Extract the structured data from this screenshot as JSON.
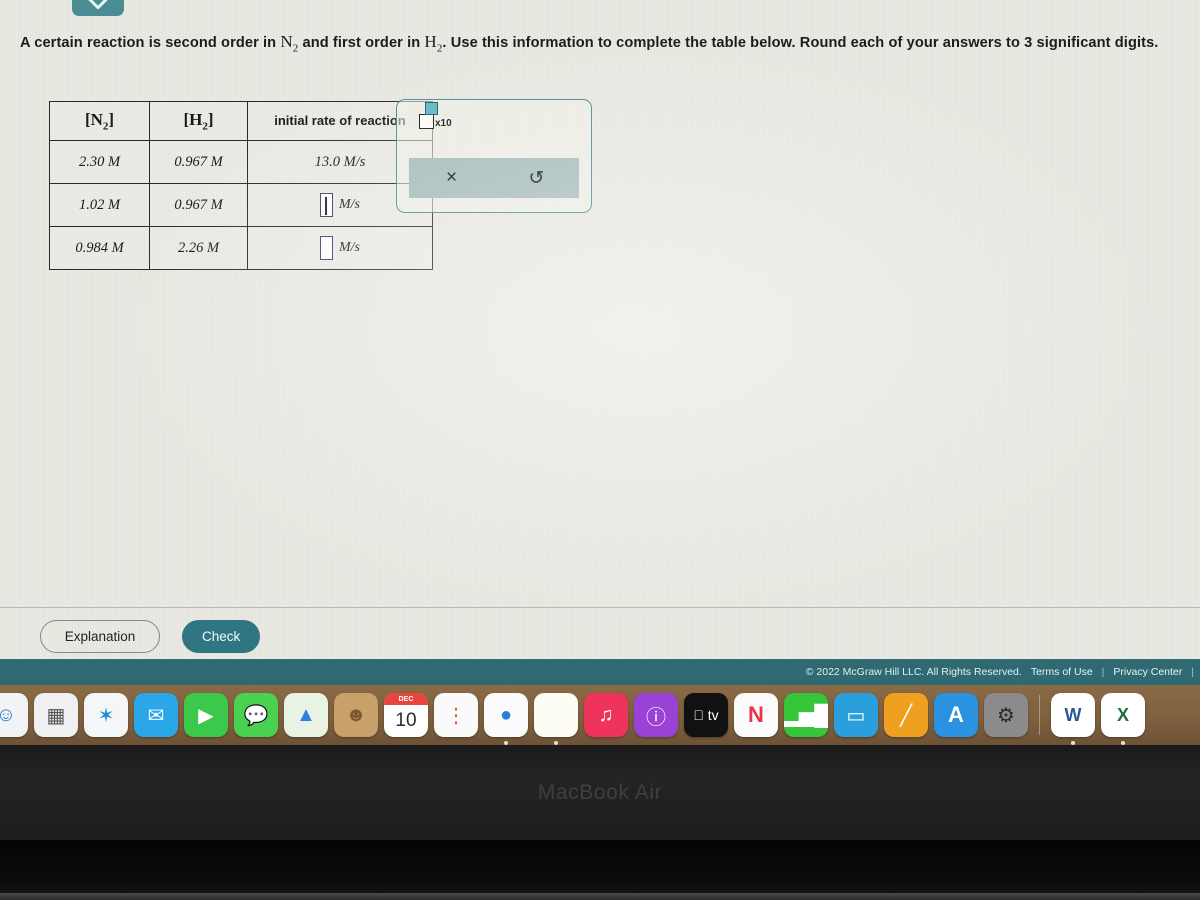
{
  "problem": {
    "text_part1": "A certain reaction is second order in ",
    "species1": "N",
    "species1_sub": "2",
    "text_part2": " and first order in ",
    "species2": "H",
    "species2_sub": "2",
    "text_part3": ". Use this information to complete the table below. Round each of your answers to 3 significant digits."
  },
  "table": {
    "headers": [
      {
        "type": "bracket",
        "symbol": "N",
        "sub": "2"
      },
      {
        "type": "bracket",
        "symbol": "H",
        "sub": "2"
      },
      {
        "type": "text",
        "label": "initial rate of reaction"
      }
    ],
    "rows": [
      {
        "n2": "2.30 M",
        "h2": "0.967 M",
        "rate_value": "13.0 M/s",
        "rate_is_input": false,
        "input_active": false,
        "unit": ""
      },
      {
        "n2": "1.02 M",
        "h2": "0.967 M",
        "rate_value": "",
        "rate_is_input": true,
        "input_active": true,
        "unit": "M/s"
      },
      {
        "n2": "0.984 M",
        "h2": "2.26 M",
        "rate_value": "",
        "rate_is_input": true,
        "input_active": false,
        "unit": "M/s"
      }
    ]
  },
  "sci_popup": {
    "x10_label": "x10",
    "clear_icon": "×",
    "undo_icon": "↺"
  },
  "actions": {
    "explanation_label": "Explanation",
    "check_label": "Check"
  },
  "footer": {
    "copyright": "© 2022 McGraw Hill LLC. All Rights Reserved.",
    "terms_label": "Terms of Use",
    "privacy_label": "Privacy Center",
    "separator": "|"
  },
  "dock": {
    "items": [
      {
        "name": "finder",
        "glyph": "☺",
        "bg": "#f2f3f5",
        "fg": "#2a7fd4",
        "running": false,
        "partial": true
      },
      {
        "name": "launchpad",
        "glyph": "▦",
        "bg": "#f0f0f2",
        "fg": "#555",
        "running": false
      },
      {
        "name": "safari",
        "glyph": "✶",
        "bg": "#f4f6f8",
        "fg": "#1c8ad6",
        "running": false
      },
      {
        "name": "mail",
        "glyph": "✉",
        "bg": "#2aa7e8",
        "fg": "#ffffff",
        "running": false
      },
      {
        "name": "facetime",
        "glyph": "▶",
        "bg": "#3cc84a",
        "fg": "#ffffff",
        "running": false
      },
      {
        "name": "messages",
        "glyph": "💬",
        "bg": "#49d14f",
        "fg": "#ffffff",
        "running": false
      },
      {
        "name": "maps",
        "glyph": "▲",
        "bg": "#e9f3e4",
        "fg": "#2f7fe0",
        "running": false
      },
      {
        "name": "contacts",
        "glyph": "☻",
        "bg": "#c7a06a",
        "fg": "#7a5a2e",
        "running": false
      },
      {
        "name": "calendar",
        "glyph": "10",
        "bg": "#ffffff",
        "fg": "#2b2b2b",
        "running": false,
        "cal_month": "DEC"
      },
      {
        "name": "reminders",
        "glyph": "⋮",
        "bg": "#fafafa",
        "fg": "#e8543a",
        "running": false
      },
      {
        "name": "chrome",
        "glyph": "●",
        "bg": "#fbfbfb",
        "fg": "#2a7fd4",
        "running": true
      },
      {
        "name": "notes",
        "glyph": "",
        "bg": "#fdfdf6",
        "fg": "#c9a227",
        "running": true
      },
      {
        "name": "music",
        "glyph": "♫",
        "bg": "#f0335a",
        "fg": "#ffffff",
        "running": false
      },
      {
        "name": "podcasts",
        "glyph": "ⓘ",
        "bg": "#9b42d6",
        "fg": "#ffffff",
        "running": false
      },
      {
        "name": "apple-tv",
        "glyph": " tv",
        "bg": "#111111",
        "fg": "#ffffff",
        "running": false
      },
      {
        "name": "news",
        "glyph": "N",
        "bg": "#fbfbfb",
        "fg": "#e8354c",
        "running": false
      },
      {
        "name": "numbers",
        "glyph": "▂▅█",
        "bg": "#35c63a",
        "fg": "#ffffff",
        "running": false
      },
      {
        "name": "keynote",
        "glyph": "▭",
        "bg": "#2a9fdc",
        "fg": "#ffffff",
        "running": false
      },
      {
        "name": "pages",
        "glyph": "╱",
        "bg": "#f0a020",
        "fg": "#ffffff",
        "running": false
      },
      {
        "name": "app-store",
        "glyph": "A",
        "bg": "#2a92e0",
        "fg": "#ffffff",
        "running": false
      },
      {
        "name": "system-preferences",
        "glyph": "⚙",
        "bg": "#8b8b8b",
        "fg": "#2a2a2a",
        "running": false
      },
      {
        "name": "separator",
        "glyph": "",
        "bg": "",
        "fg": "",
        "running": false,
        "is_separator": true
      },
      {
        "name": "microsoft-word",
        "glyph": "W",
        "bg": "#ffffff",
        "fg": "#2b579a",
        "running": true
      },
      {
        "name": "microsoft-excel",
        "glyph": "X",
        "bg": "#ffffff",
        "fg": "#1d6f42",
        "running": true
      }
    ]
  },
  "laptop": {
    "model_label": "MacBook Air"
  },
  "colors": {
    "teal_accent": "#2f7682",
    "footer_bar": "#2f6a73",
    "page_bg": "#e9e8e1",
    "popup_border": "#4a8c93",
    "popup_toolbar": "#a8bcbd",
    "input_border": "#3a3f6b",
    "dock_bg": "#7d5f3e"
  }
}
